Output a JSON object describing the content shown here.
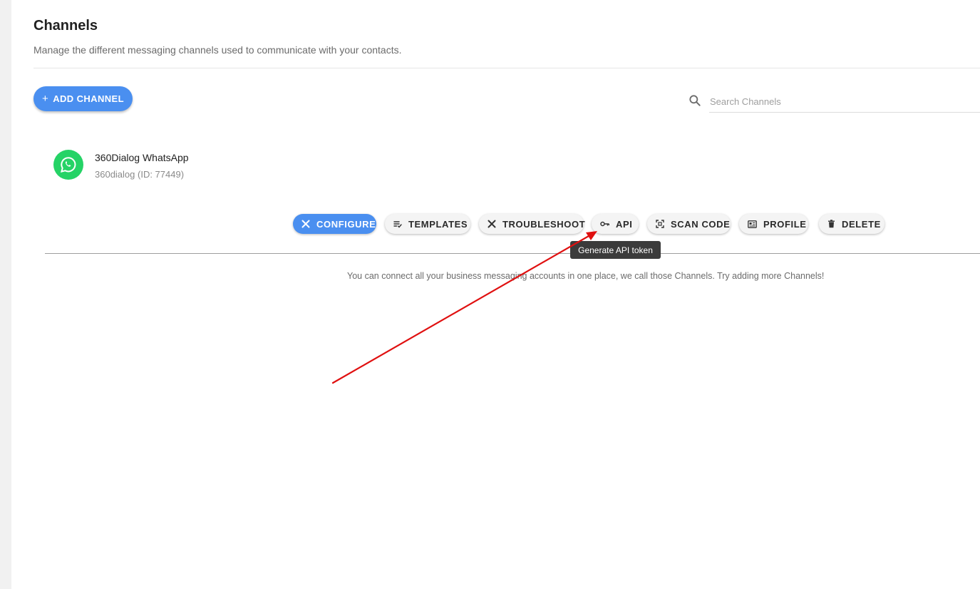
{
  "header": {
    "title": "Channels",
    "subtitle": "Manage the different messaging channels used to communicate with your contacts."
  },
  "toolbar": {
    "add_label": "ADD CHANNEL",
    "add_icon": "plus-icon",
    "search_placeholder": "Search Channels",
    "search_value": ""
  },
  "channel": {
    "name": "360Dialog WhatsApp",
    "sub": "360dialog (ID: 77449)",
    "icon": "whatsapp-icon",
    "brand_color": "#25D366"
  },
  "actions": [
    {
      "label": "CONFIGURE",
      "icon": "tools-icon"
    },
    {
      "label": "TEMPLATES",
      "icon": "list-check-icon"
    },
    {
      "label": "TROUBLESHOOT",
      "icon": "wrench-icon"
    },
    {
      "label": "API",
      "icon": "key-icon"
    },
    {
      "label": "SCAN CODE",
      "icon": "qr-scan-icon"
    },
    {
      "label": "PROFILE",
      "icon": "id-card-icon"
    },
    {
      "label": "DELETE",
      "icon": "trash-icon"
    }
  ],
  "tooltip": "Generate API token",
  "empty_message": "You can connect all your business messaging accounts in one place, we call those Channels. Try adding more Channels!",
  "colors": {
    "primary": "#4A8FF0",
    "annotation_arrow": "#E01010",
    "tooltip_bg": "#3B3B3B"
  }
}
